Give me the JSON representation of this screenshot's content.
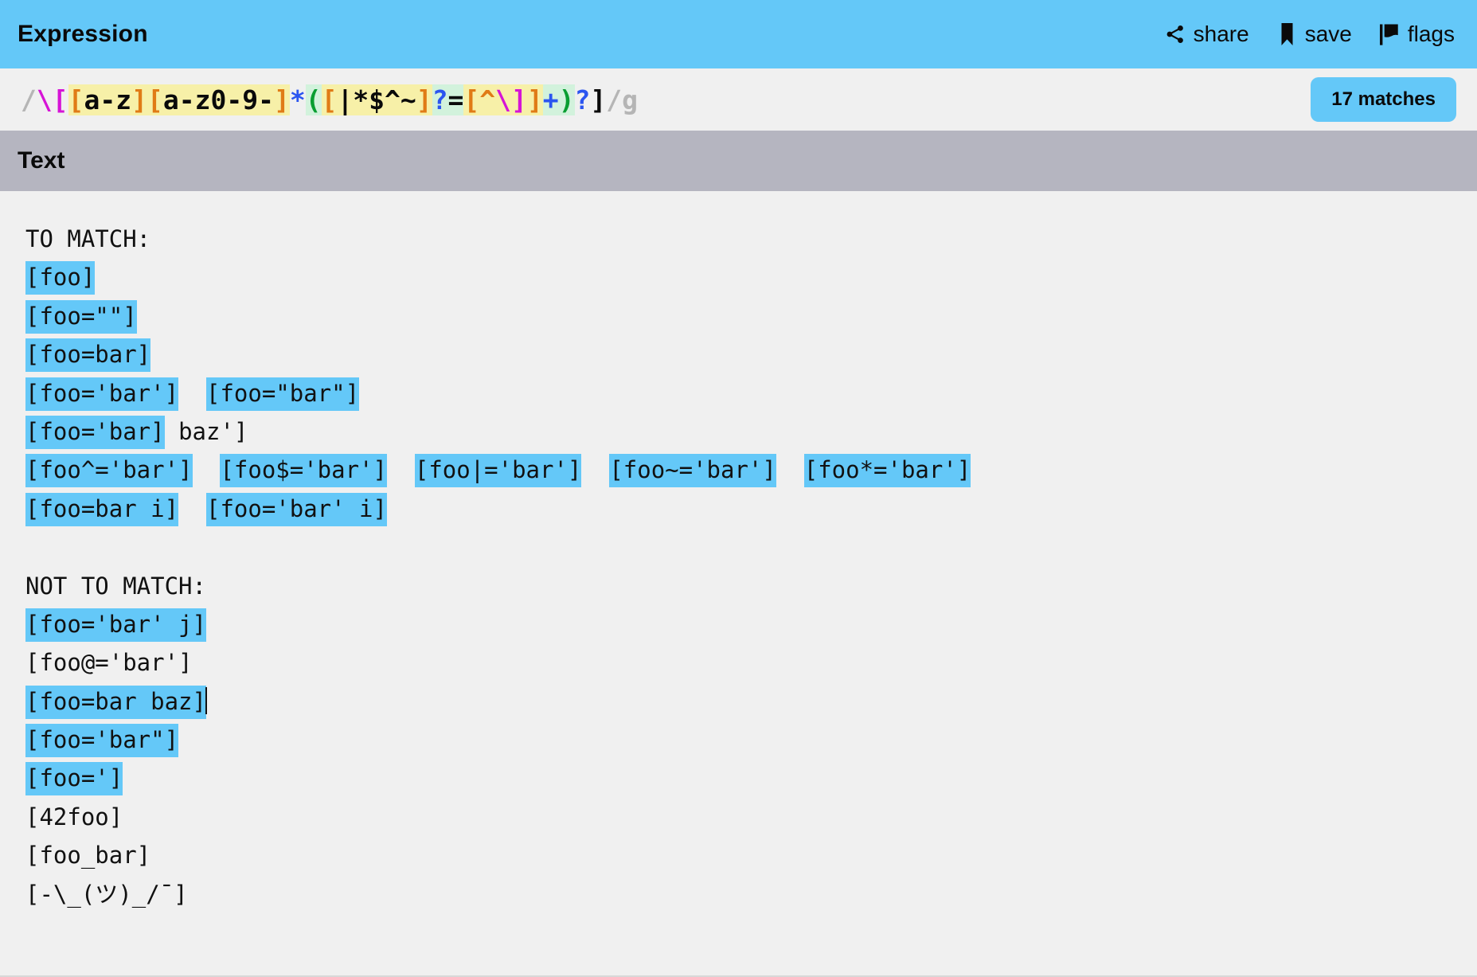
{
  "expression_panel": {
    "title": "Expression",
    "actions": [
      {
        "label": "share",
        "icon": "share-icon"
      },
      {
        "label": "save",
        "icon": "bookmark-icon"
      },
      {
        "label": "flags",
        "icon": "flag-icon"
      }
    ],
    "matches_badge": "17 matches",
    "regex": {
      "full": "/\\[[a-z][a-z0-9-]*([|*$^~]?=[^\\]]+)?]/g",
      "flags": "g",
      "tokens": [
        {
          "text": "/",
          "role": "delimiter"
        },
        {
          "text": "\\",
          "role": "escape"
        },
        {
          "text": "[",
          "role": "escaped-literal"
        },
        {
          "text": "[",
          "role": "class-bracket",
          "hl": "yellow"
        },
        {
          "text": "a-z",
          "role": "class-text",
          "hl": "yellow"
        },
        {
          "text": "]",
          "role": "class-bracket",
          "hl": "yellow"
        },
        {
          "text": "[",
          "role": "class-bracket",
          "hl": "yellow"
        },
        {
          "text": "a-z0-9-",
          "role": "class-text",
          "hl": "yellow"
        },
        {
          "text": "]",
          "role": "class-bracket",
          "hl": "yellow"
        },
        {
          "text": "*",
          "role": "quantifier"
        },
        {
          "text": "(",
          "role": "group",
          "hl": "green"
        },
        {
          "text": "[",
          "role": "class-bracket",
          "hl": "yellow"
        },
        {
          "text": "|*$^~",
          "role": "class-text",
          "hl": "yellow"
        },
        {
          "text": "]",
          "role": "class-bracket",
          "hl": "yellow"
        },
        {
          "text": "?",
          "role": "quantifier",
          "hl": "green"
        },
        {
          "text": "=",
          "role": "literal",
          "hl": "green"
        },
        {
          "text": "[",
          "role": "class-bracket",
          "hl": "yellow"
        },
        {
          "text": "^",
          "role": "class-negate",
          "hl": "yellow"
        },
        {
          "text": "\\",
          "role": "escape",
          "hl": "yellow"
        },
        {
          "text": "]",
          "role": "escaped-literal",
          "hl": "yellow"
        },
        {
          "text": "]",
          "role": "class-bracket",
          "hl": "yellow"
        },
        {
          "text": "+",
          "role": "quantifier",
          "hl": "green"
        },
        {
          "text": ")",
          "role": "group",
          "hl": "green"
        },
        {
          "text": "?",
          "role": "quantifier"
        },
        {
          "text": "]",
          "role": "literal"
        },
        {
          "text": "/",
          "role": "delimiter"
        },
        {
          "text": "g",
          "role": "flags"
        }
      ]
    },
    "colors": {
      "header_bg": "#64c8f8",
      "badge_bg": "#64c8f8",
      "panel_bg": "#f0f0f0",
      "delimiter": "#b5b5b5",
      "escape": "#d614d6",
      "class_bracket": "#e07b16",
      "quantifier": "#2b55f0",
      "group": "#0a9e32",
      "literal": "#0a0a0a",
      "hl_yellow": "#f7f0a8",
      "hl_green": "#d2f2dc"
    }
  },
  "text_panel": {
    "title": "Text",
    "header_bg": "#b5b5c0",
    "match_highlight": "#64c8f8",
    "lines": [
      {
        "segments": [
          {
            "t": "TO MATCH:",
            "m": false
          }
        ]
      },
      {
        "segments": [
          {
            "t": "[foo]",
            "m": true
          }
        ]
      },
      {
        "segments": [
          {
            "t": "[foo=\"\"]",
            "m": true
          }
        ]
      },
      {
        "segments": [
          {
            "t": "[foo=bar]",
            "m": true
          }
        ]
      },
      {
        "segments": [
          {
            "t": "[foo='bar']",
            "m": true
          },
          {
            "t": "  ",
            "m": false
          },
          {
            "t": "[foo=\"bar\"]",
            "m": true
          }
        ]
      },
      {
        "segments": [
          {
            "t": "[foo='bar]",
            "m": true
          },
          {
            "t": " baz']",
            "m": false
          }
        ]
      },
      {
        "segments": [
          {
            "t": "[foo^='bar']",
            "m": true
          },
          {
            "t": "  ",
            "m": false
          },
          {
            "t": "[foo$='bar']",
            "m": true
          },
          {
            "t": "  ",
            "m": false
          },
          {
            "t": "[foo|='bar']",
            "m": true
          },
          {
            "t": "  ",
            "m": false
          },
          {
            "t": "[foo~='bar']",
            "m": true
          },
          {
            "t": "  ",
            "m": false
          },
          {
            "t": "[foo*='bar']",
            "m": true
          }
        ]
      },
      {
        "segments": [
          {
            "t": "[foo=bar i]",
            "m": true
          },
          {
            "t": "  ",
            "m": false
          },
          {
            "t": "[foo='bar' i]",
            "m": true
          }
        ]
      },
      {
        "segments": [
          {
            "t": " ",
            "m": false
          }
        ]
      },
      {
        "segments": [
          {
            "t": "NOT TO MATCH:",
            "m": false
          }
        ]
      },
      {
        "segments": [
          {
            "t": "[foo='bar' j]",
            "m": true
          }
        ]
      },
      {
        "segments": [
          {
            "t": "[foo@='bar']",
            "m": false
          }
        ]
      },
      {
        "segments": [
          {
            "t": "[foo=bar baz]",
            "m": true
          }
        ],
        "caret_after": true
      },
      {
        "segments": [
          {
            "t": "[foo='bar\"]",
            "m": true
          }
        ]
      },
      {
        "segments": [
          {
            "t": "[foo=']",
            "m": true
          }
        ]
      },
      {
        "segments": [
          {
            "t": "[42foo]",
            "m": false
          }
        ]
      },
      {
        "segments": [
          {
            "t": "[foo_bar]",
            "m": false
          }
        ]
      },
      {
        "segments": [
          {
            "t": "[-\\_(ツ)_/¯]",
            "m": false
          }
        ]
      }
    ]
  }
}
